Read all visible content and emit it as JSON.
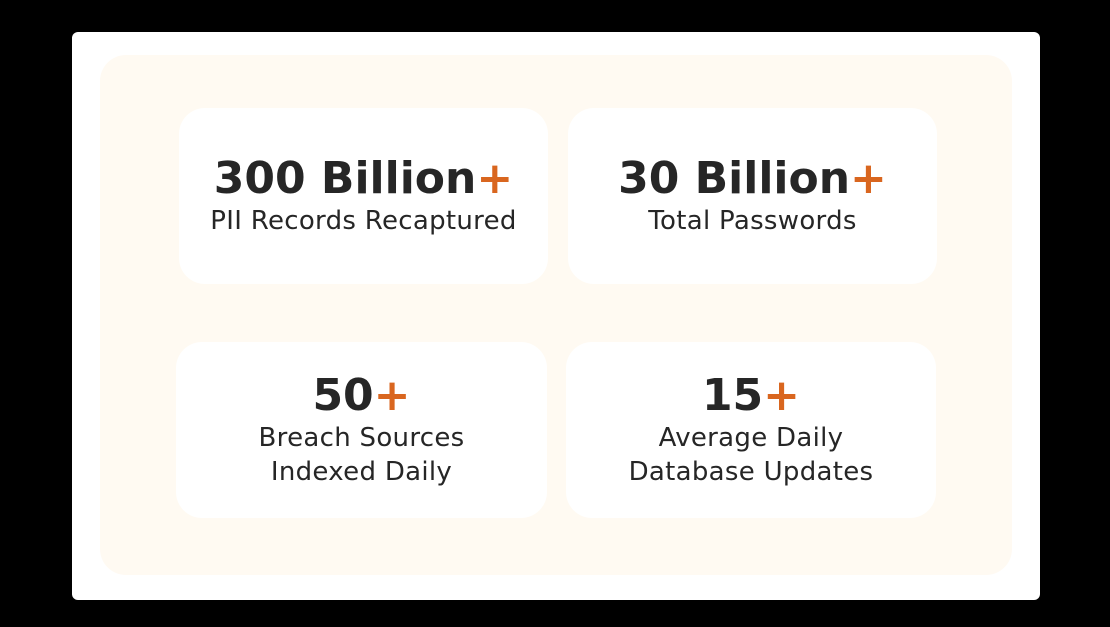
{
  "colors": {
    "accent": "#d9661f",
    "text": "#262626",
    "panel_background": "#fffaf2",
    "card_background": "#ffffff"
  },
  "stats": [
    {
      "value": "300 Billion",
      "suffix": "+",
      "label_lines": [
        "PII Records Recaptured"
      ]
    },
    {
      "value": "30 Billion",
      "suffix": "+",
      "label_lines": [
        "Total Passwords"
      ]
    },
    {
      "value": "50",
      "suffix": "+",
      "label_lines": [
        "Breach Sources",
        "Indexed Daily"
      ]
    },
    {
      "value": "15",
      "suffix": "+",
      "label_lines": [
        "Average Daily",
        "Database Updates"
      ]
    }
  ]
}
